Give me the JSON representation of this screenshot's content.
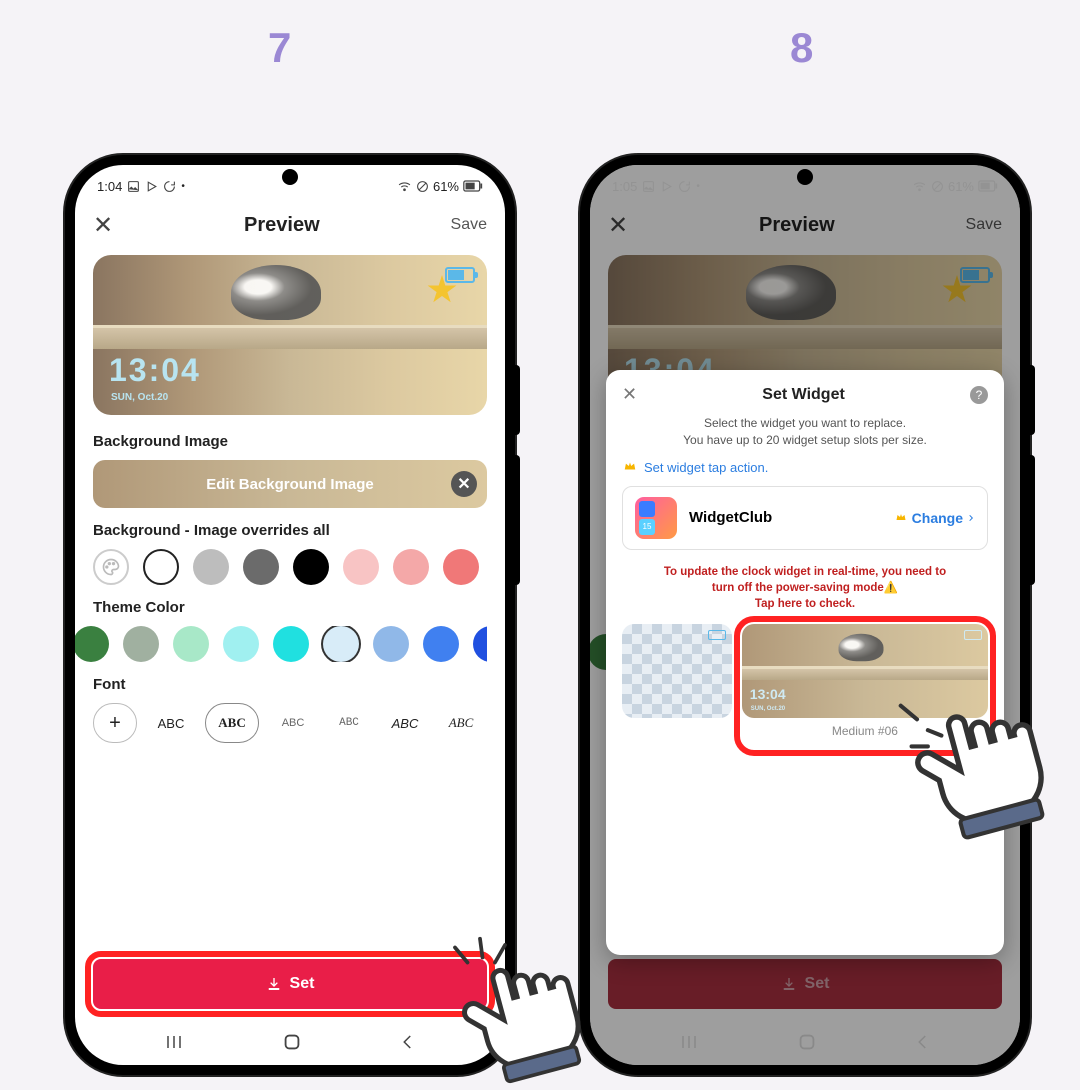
{
  "steps": {
    "left": "7",
    "right": "8"
  },
  "status": {
    "time_left": "1:04",
    "time_right": "1:05",
    "battery_pct": "61%"
  },
  "header": {
    "title": "Preview",
    "save": "Save"
  },
  "preview_widget": {
    "time": "13:04",
    "date": "SUN, Oct.20"
  },
  "sections": {
    "bg_image": "Background Image",
    "edit_bg": "Edit Background Image",
    "bg_color": "Background - Image overrides all",
    "theme": "Theme Color",
    "font": "Font"
  },
  "font_samples": [
    "+",
    "ABC",
    "ABC",
    "ABC",
    "ABC",
    "ABC",
    "ABC"
  ],
  "set_button": "Set",
  "modal": {
    "title": "Set Widget",
    "desc1": "Select the widget you want to replace.",
    "desc2": "You have up to 20 widget setup slots per size.",
    "tap_action": "Set widget tap action.",
    "app_name": "WidgetClub",
    "change": "Change",
    "warn1": "To update the clock widget in real-time, you need to",
    "warn2": "turn off the power-saving mode⚠️",
    "warn3": "Tap here to check.",
    "slot_label": "Medium #06",
    "slot_time": "13:04",
    "slot_date": "SUN, Oct.20"
  },
  "colors": {
    "bg_swatches": [
      "#bdbdbd",
      "#6b6b6b",
      "#000000",
      "#f8c4c4",
      "#f4a8a8",
      "#f07878"
    ],
    "theme_swatches": [
      "#a0b0a0",
      "#a8e8c8",
      "#a0f0f0",
      "#20e0e0",
      "#b0d8f0",
      "#4080f0",
      "#2050e0"
    ],
    "theme_selected_index": 4
  }
}
